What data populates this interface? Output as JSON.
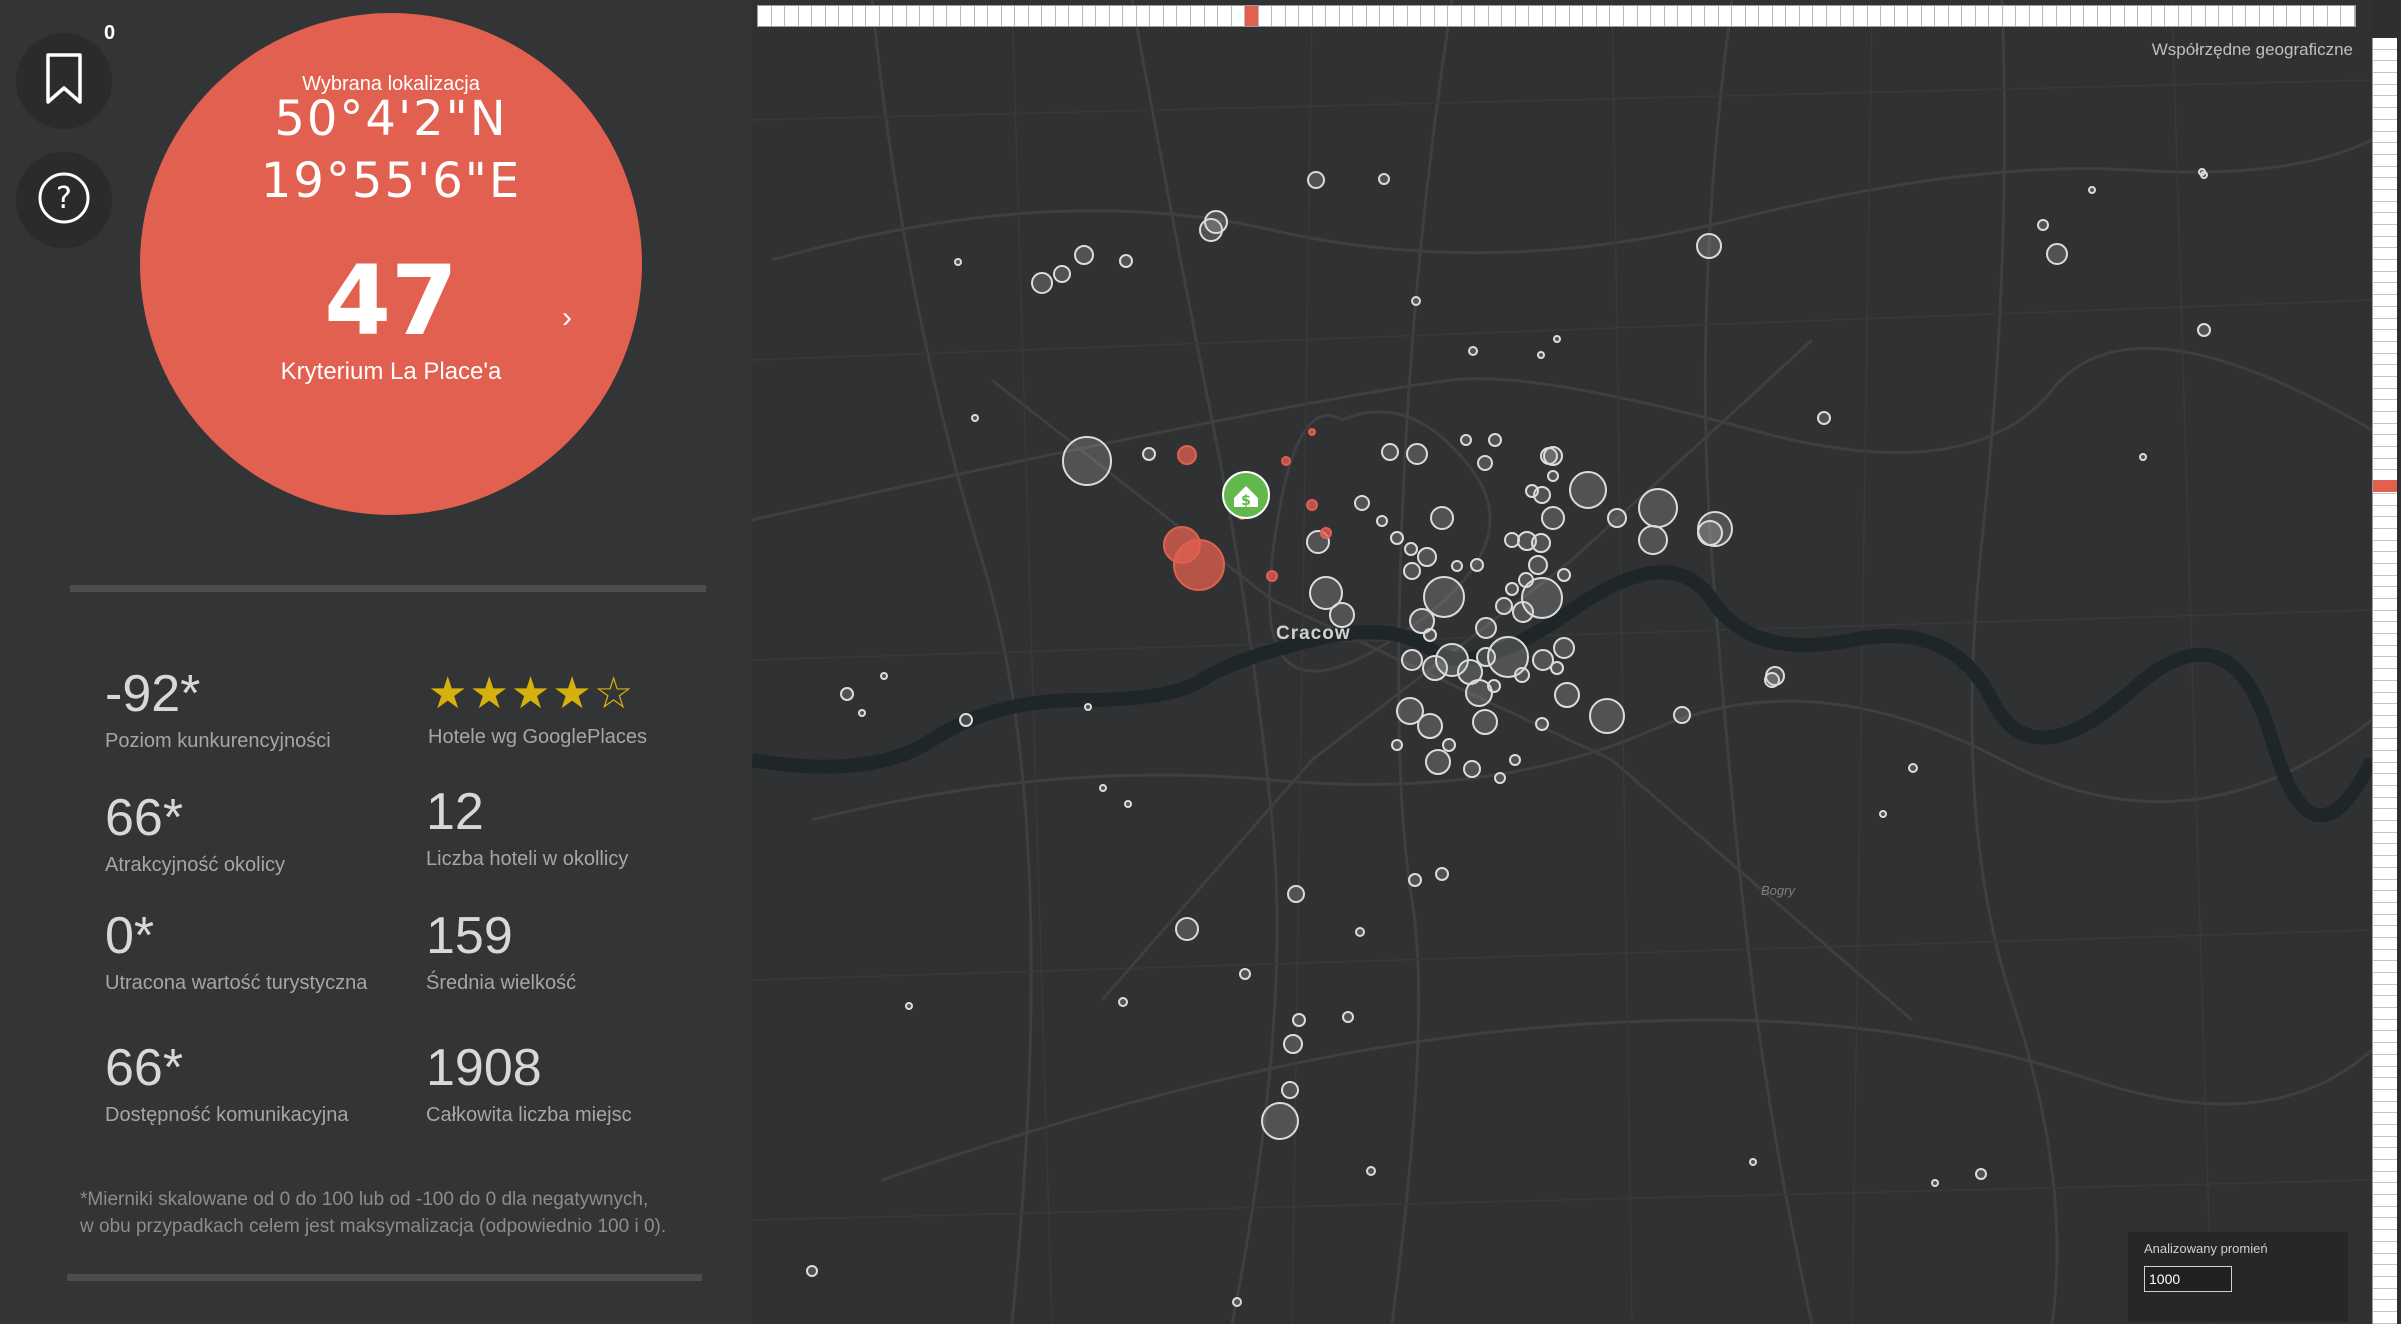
{
  "bookmark": {
    "count": "0",
    "icon": "bookmark-icon"
  },
  "help": {
    "icon": "question-mark-icon"
  },
  "selected": {
    "label": "Wybrana lokalizacja",
    "lat": "50°4'2\"N",
    "lon": "19°55'6\"E",
    "score": "47",
    "score_label": "Kryterium La Place'a",
    "chevron": "›"
  },
  "metrics": [
    {
      "value": "-92*",
      "label": "Poziom kunkurencyjności"
    },
    {
      "value": "66*",
      "label": "Atrakcyjność okolicy"
    },
    {
      "value": "0*",
      "label": "Utracona wartość turystyczna"
    },
    {
      "value": "66*",
      "label": "Dostępność komunikacyjna"
    }
  ],
  "stats": [
    {
      "label": "Hotele wg GooglePlaces",
      "rating": 4,
      "rating_max": 5
    },
    {
      "value": "12",
      "label": "Liczba hoteli w okollicy"
    },
    {
      "value": "159",
      "label": "Średnia wielkość"
    },
    {
      "value": "1908",
      "label": "Całkowita liczba miejsc"
    }
  ],
  "footnote": {
    "line1": "*Mierniki skalowane od 0 do 100 lub od -100 do 0 dla negatywnych,",
    "line2": "w obu przypadkach celem jest maksymalizacja (odpowiednio 100 i 0)."
  },
  "map": {
    "title": "Współrzędne geograficzne",
    "city": "Cracow",
    "district": "Bogry",
    "radius_label": "Analizowany promień",
    "radius_value": "1000",
    "timeline_active_index": 36,
    "timeline_count": 118,
    "colors": {
      "accent": "#e2604f",
      "marker": "#62b84a",
      "star": "#d6b00c"
    }
  }
}
